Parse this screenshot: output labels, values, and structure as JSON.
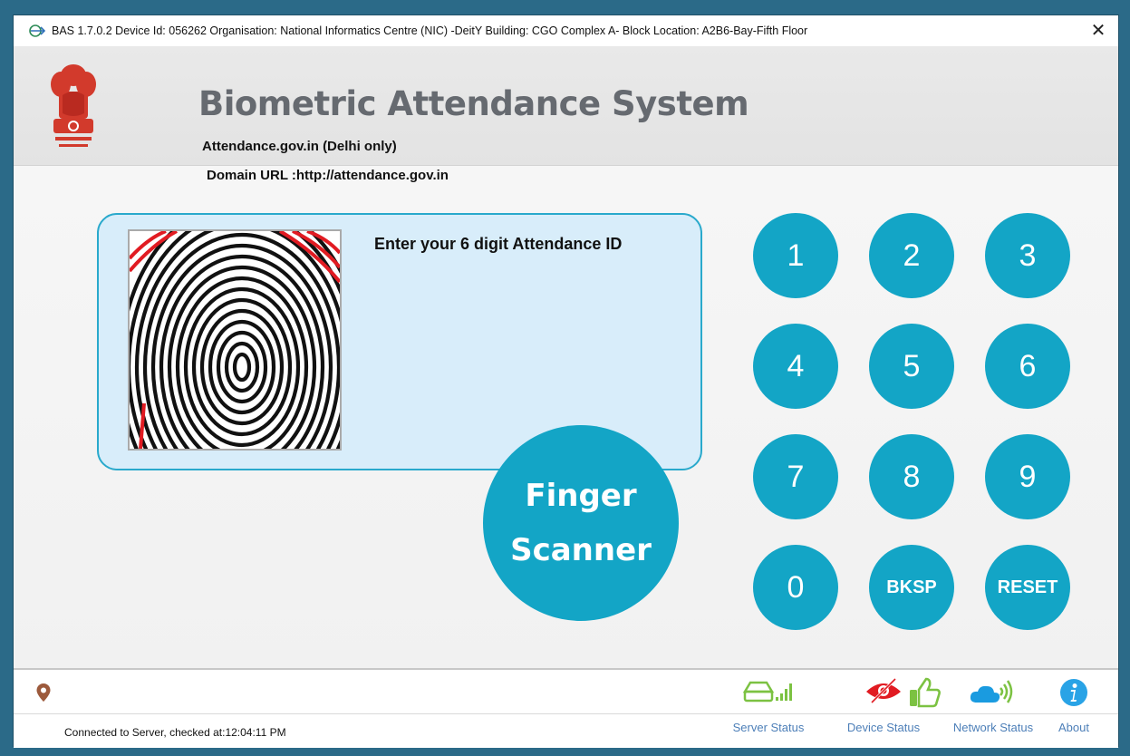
{
  "window": {
    "title": "BAS 1.7.0.2 Device Id: 056262 Organisation: National Informatics Centre (NIC) -DeitY Building: CGO Complex A- Block  Location: A2B6-Bay-Fifth Floor",
    "close_label": "✕"
  },
  "header": {
    "title": "Biometric Attendance System",
    "subtitle": "Attendance.gov.in (Delhi only)",
    "domain": "Domain URL :http://attendance.gov.in"
  },
  "panel": {
    "prompt": "Enter your 6 digit Attendance ID"
  },
  "scanner": {
    "line1": "Finger",
    "line2": "Scanner"
  },
  "keypad": {
    "k1": "1",
    "k2": "2",
    "k3": "3",
    "k4": "4",
    "k5": "5",
    "k6": "6",
    "k7": "7",
    "k8": "8",
    "k9": "9",
    "k0": "0",
    "bksp": "BKSP",
    "reset": "RESET"
  },
  "status": {
    "server": "Server Status",
    "device": "Device Status",
    "network": "Network Status",
    "about": "About",
    "connection": "Connected to Server, checked at:12:04:11 PM"
  },
  "colors": {
    "accent": "#13a5c6",
    "panel_bg": "#d8edfa",
    "title_gray": "#666a70",
    "status_green": "#7cc242",
    "status_red": "#e11b22",
    "link_blue": "#4d7fb8"
  }
}
